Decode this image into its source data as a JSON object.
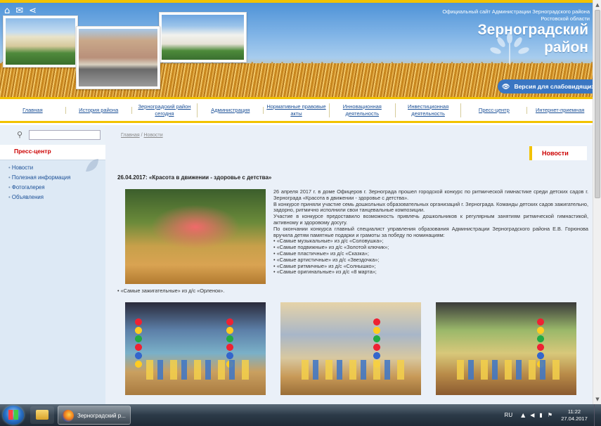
{
  "header": {
    "official_text": "Официальный сайт Администрации Зерноградского района Ростовской области",
    "district_line1": "Зерноградский",
    "district_line2": "район",
    "vision_label": "Версия для слабовидящих"
  },
  "top_icons": [
    "home-icon",
    "mail-icon",
    "share-icon"
  ],
  "nav": {
    "items": [
      {
        "label": "Главная"
      },
      {
        "label": "История района"
      },
      {
        "label": "Зерноградский район сегодня"
      },
      {
        "label": "Администрация"
      },
      {
        "label": "Нормативные правовые акты"
      },
      {
        "label": "Инновационная деятельность"
      },
      {
        "label": "Инвестиционная деятельность"
      },
      {
        "label": "Пресс-центр"
      },
      {
        "label": "Интернет-приемная"
      }
    ]
  },
  "search": {
    "value": ""
  },
  "sidebar": {
    "heading": "Пресс-центр",
    "items": [
      {
        "label": "Новости"
      },
      {
        "label": "Полезная информация"
      },
      {
        "label": "Фотогалерея"
      },
      {
        "label": "Объявления"
      }
    ]
  },
  "breadcrumb": {
    "home": "Главная",
    "sep": " / ",
    "current": "Новости"
  },
  "section_title": "Новости",
  "article": {
    "title": "26.04.2017: «Красота в движении - здоровье с детства»",
    "paragraphs": [
      "26 апреля 2017 г. в доме Офицеров г. Зернограда прошел городской конкурс по ритмической гимнастике среди детских садов г. Зернограда «Красота в движении - здоровье с детства».",
      "В конкурсе приняли участие семь дошкольных образовательных организаций г. Зернограда. Команды детских садов зажигательно, задорно, ритмично исполнили свои танцевальные композиции.",
      "Участие в конкурсе предоставило возможность привлечь дошкольников к регулярным занятиям ритмической гимнастикой, активному и здоровому досугу.",
      "По окончании конкурса главный специалист управления образования Администрации Зерноградского района Е.В. Горюнова вручила детям памятные подарки и грамоты за победу по номинациям:"
    ],
    "nominations": [
      "«Самые музыкальные» из д/с «Соловушка»;",
      "«Самые подвижные» из д/с «Золотой ключик»;",
      "«Самые пластичные» из д/с «Сказка»;",
      "«Самые артистичные» из д/с «Звездочка»;",
      "«Самые ритмичные» из д/с «Солнышко»;",
      "«Самые оригинальные» из д/с «8 марта»;"
    ],
    "last_nomination": "«Самые зажигательные» из д/с «Орленок»."
  },
  "taskbar": {
    "window_title": "Зерноградский р...",
    "lang": "RU",
    "time": "11:22",
    "date": "27.04.2017"
  },
  "colors": {
    "accent_yellow": "#f2c200",
    "link_blue": "#1a4f96",
    "heading_red": "#cc0000",
    "vision_blue": "#3a76c2"
  }
}
